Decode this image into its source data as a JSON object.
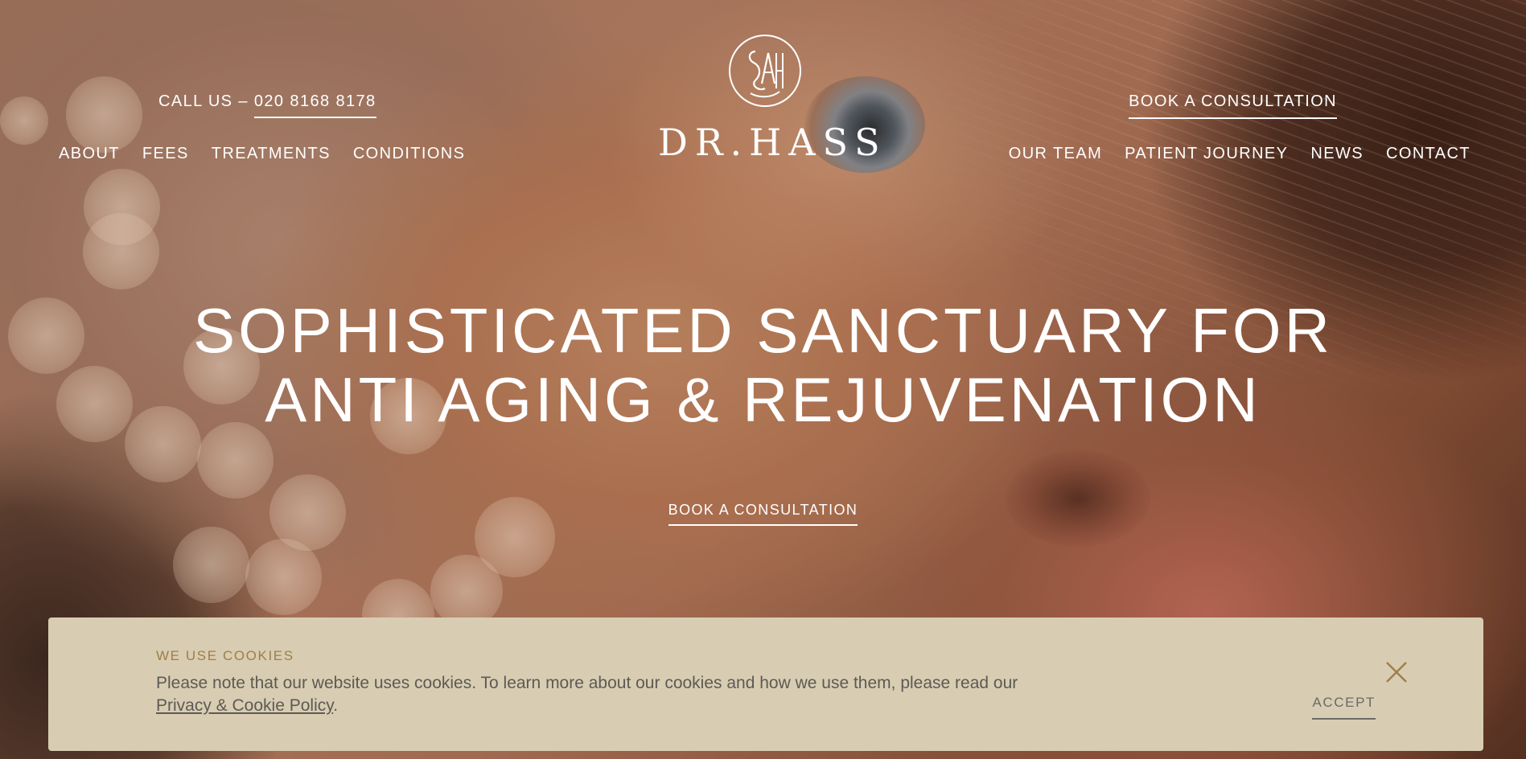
{
  "header": {
    "phone_prefix": "CALL US –",
    "phone_number": "020 8168 8178",
    "book_label": "BOOK A CONSULTATION",
    "nav_left": [
      "ABOUT",
      "FEES",
      "TREATMENTS",
      "CONDITIONS"
    ],
    "nav_right": [
      "OUR TEAM",
      "PATIENT JOURNEY",
      "NEWS",
      "CONTACT"
    ],
    "logo_text": "DR.HASS"
  },
  "hero": {
    "headline_line1": "SOPHISTICATED SANCTUARY FOR",
    "headline_line2": "ANTI AGING & REJUVENATION",
    "cta_label": "BOOK A CONSULTATION"
  },
  "cookie_banner": {
    "title": "WE USE COOKIES",
    "text_before": "Please note that our website uses cookies. To learn more about our cookies and how we use them, please read our ",
    "link_text": "Privacy & Cookie Policy",
    "text_after": ".",
    "accept_label": "ACCEPT",
    "close_icon": "close-icon"
  },
  "colors": {
    "banner_bg": "#d8cdb2",
    "banner_title": "#a07e47",
    "banner_text": "#5d5a55",
    "header_text": "#ffffff"
  }
}
